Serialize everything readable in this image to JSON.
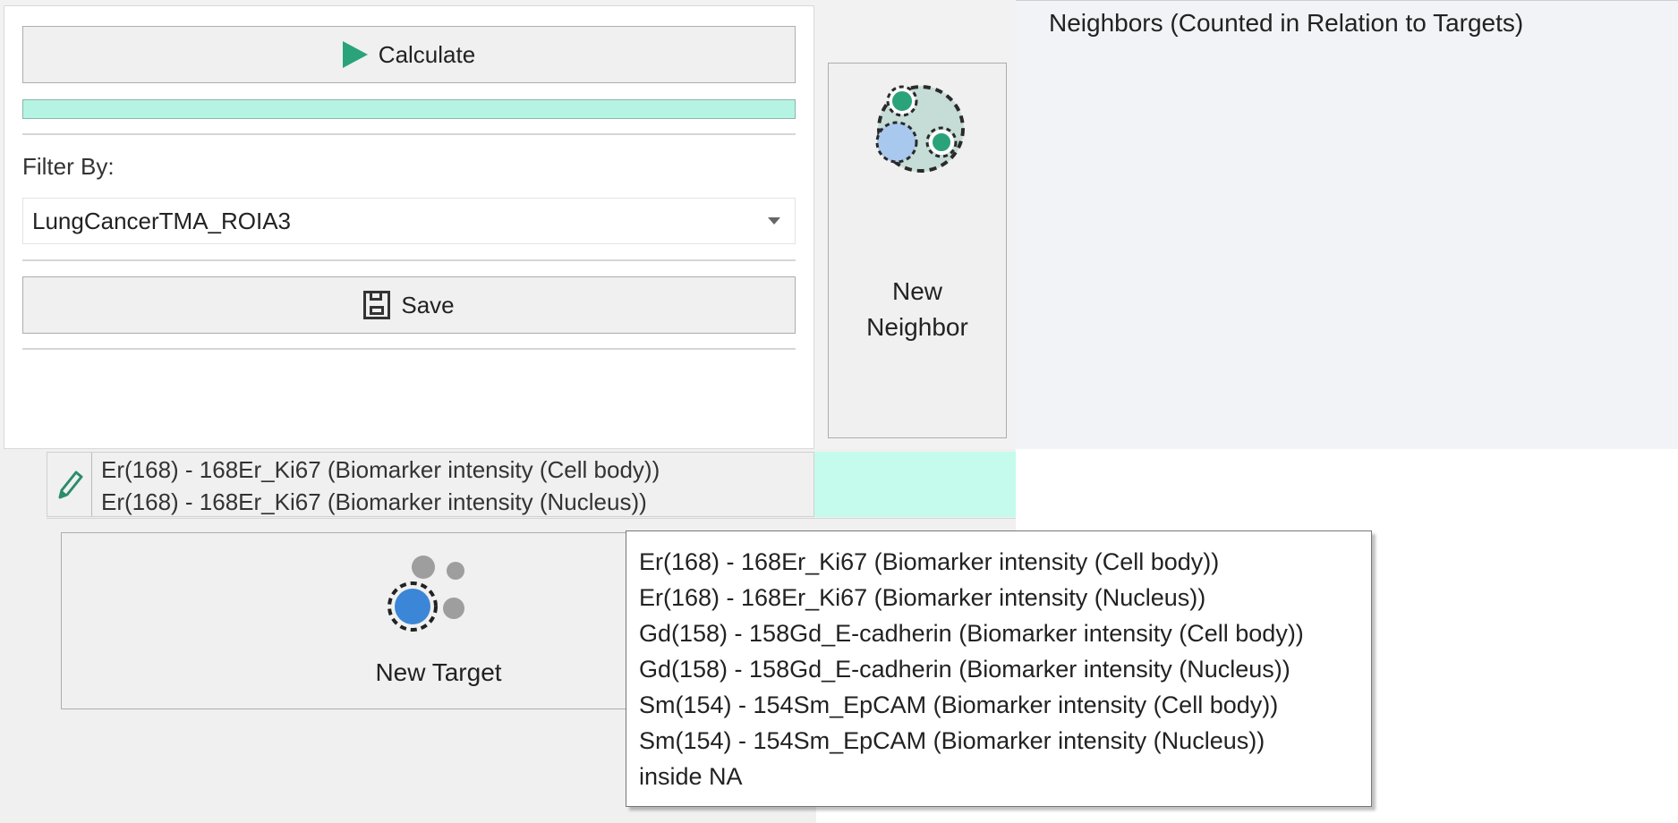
{
  "calculate": {
    "label": "Calculate",
    "icon": "play-icon",
    "icon_color": "#2aa37a"
  },
  "progress": {
    "fraction": 1.0,
    "color": "#c4fbed"
  },
  "filter": {
    "label": "Filter By:",
    "value": "LungCancerTMA_ROIA3"
  },
  "save": {
    "label": "Save",
    "icon": "save-icon"
  },
  "new_neighbor": {
    "line1": "New",
    "line2": "Neighbor",
    "icon": "neighbors-icon"
  },
  "neighbors_title": "Neighbors (Counted in Relation to Targets)",
  "edit_row": {
    "lines": [
      "Er(168) - 168Er_Ki67 (Biomarker intensity (Cell body))",
      "Er(168) - 168Er_Ki67 (Biomarker intensity (Nucleus))"
    ],
    "icon": "pencil-icon"
  },
  "new_target": {
    "label": "New Target",
    "icon": "target-cells-icon"
  },
  "tooltip": {
    "lines": [
      "Er(168) - 168Er_Ki67 (Biomarker intensity (Cell body))",
      "Er(168) - 168Er_Ki67 (Biomarker intensity (Nucleus))",
      "Gd(158) - 158Gd_E-cadherin (Biomarker intensity (Cell body))",
      "Gd(158) - 158Gd_E-cadherin (Biomarker intensity (Nucleus))",
      "Sm(154) - 154Sm_EpCAM (Biomarker intensity (Cell body))",
      "Sm(154) - 154Sm_EpCAM (Biomarker intensity (Nucleus))",
      "inside NA"
    ]
  }
}
